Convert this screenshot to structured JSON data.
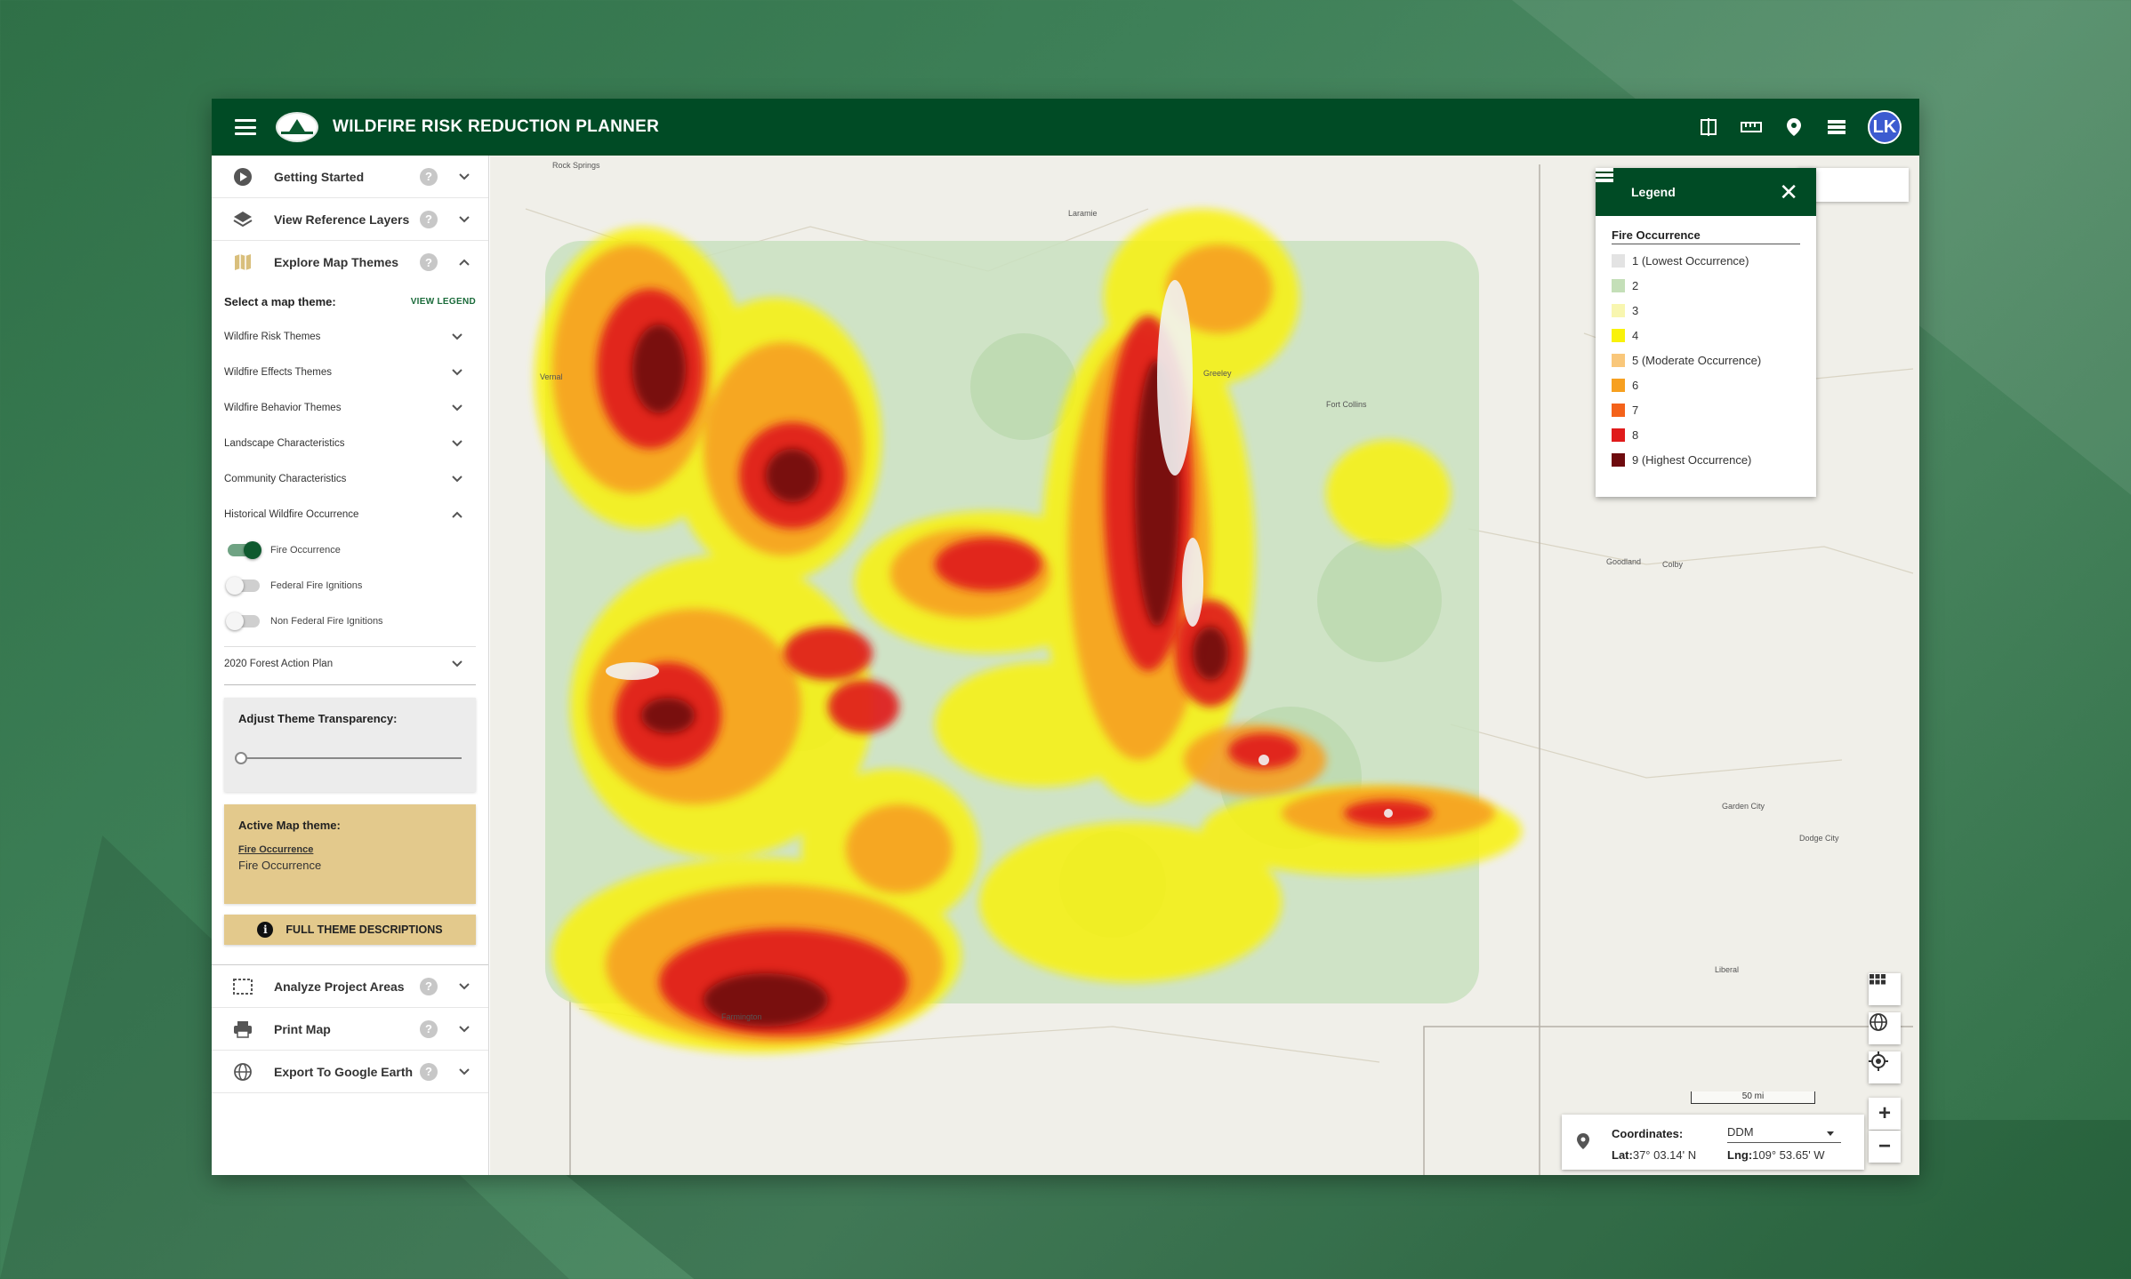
{
  "header": {
    "title": "WILDFIRE RISK REDUCTION PLANNER",
    "avatar_initials": "LK",
    "color": "#004b25"
  },
  "sidebar": {
    "sections_top": [
      {
        "label": "Getting Started",
        "icon": "play-circle-icon"
      },
      {
        "label": "View Reference Layers",
        "icon": "layers-icon"
      },
      {
        "label": "Explore Map Themes",
        "icon": "map-icon"
      }
    ],
    "theme_prompt": "Select a map theme:",
    "view_legend": "VIEW LEGEND",
    "themes": [
      "Wildfire Risk Themes",
      "Wildfire Effects Themes",
      "Wildfire Behavior Themes",
      "Landscape Characteristics",
      "Community Characteristics",
      "Historical Wildfire Occurrence"
    ],
    "toggles": [
      {
        "label": "Fire Occurrence",
        "on": true
      },
      {
        "label": "Federal Fire Ignitions",
        "on": false
      },
      {
        "label": "Non Federal Fire Ignitions",
        "on": false
      }
    ],
    "forest_plan": "2020 Forest Action Plan",
    "transparency_label": "Adjust Theme Transparency:",
    "transparency_value": 0,
    "active_theme_label": "Active Map theme:",
    "active_theme_link": "Fire Occurrence",
    "active_theme_name": "Fire Occurrence",
    "full_desc_button": "FULL THEME DESCRIPTIONS",
    "sections_bottom": [
      {
        "label": "Analyze Project Areas",
        "icon": "select-area-icon"
      },
      {
        "label": "Print Map",
        "icon": "printer-icon"
      },
      {
        "label": "Export To Google Earth",
        "icon": "globe-icon"
      }
    ]
  },
  "legend": {
    "header": "Legend",
    "title": "Fire Occurrence",
    "items": [
      {
        "label": "1 (Lowest Occurrence)",
        "color": "#e3e3e3"
      },
      {
        "label": "2",
        "color": "#c4dfb8"
      },
      {
        "label": "3",
        "color": "#f8f6b0"
      },
      {
        "label": "4",
        "color": "#f9f20a"
      },
      {
        "label": "5 (Moderate Occurrence)",
        "color": "#f9c77a"
      },
      {
        "label": "6",
        "color": "#f7a020"
      },
      {
        "label": "7",
        "color": "#f4621a"
      },
      {
        "label": "8",
        "color": "#e01b1b"
      },
      {
        "label": "9 (Highest Occurrence)",
        "color": "#6e0b0e"
      }
    ]
  },
  "coords": {
    "label": "Coordinates:",
    "format": "DDM",
    "lat_label": "Lat:",
    "lat": "37° 03.14' N",
    "lng_label": "Lng:",
    "lng": "109° 53.65' W"
  },
  "scale": "50 mi",
  "map_controls": [
    "basemap-grid-icon",
    "globe-icon",
    "locate-icon",
    "zoom-in-icon",
    "zoom-out-icon"
  ],
  "places": [
    {
      "label": "Rock Springs"
    },
    {
      "label": "Laramie"
    },
    {
      "label": "Vernal"
    },
    {
      "label": "Goodland"
    },
    {
      "label": "Colby"
    },
    {
      "label": "Garden City"
    },
    {
      "label": "Dodge City"
    },
    {
      "label": "Liberal"
    },
    {
      "label": "Farmington"
    },
    {
      "label": "Fort Collins"
    },
    {
      "label": "Greeley"
    }
  ]
}
